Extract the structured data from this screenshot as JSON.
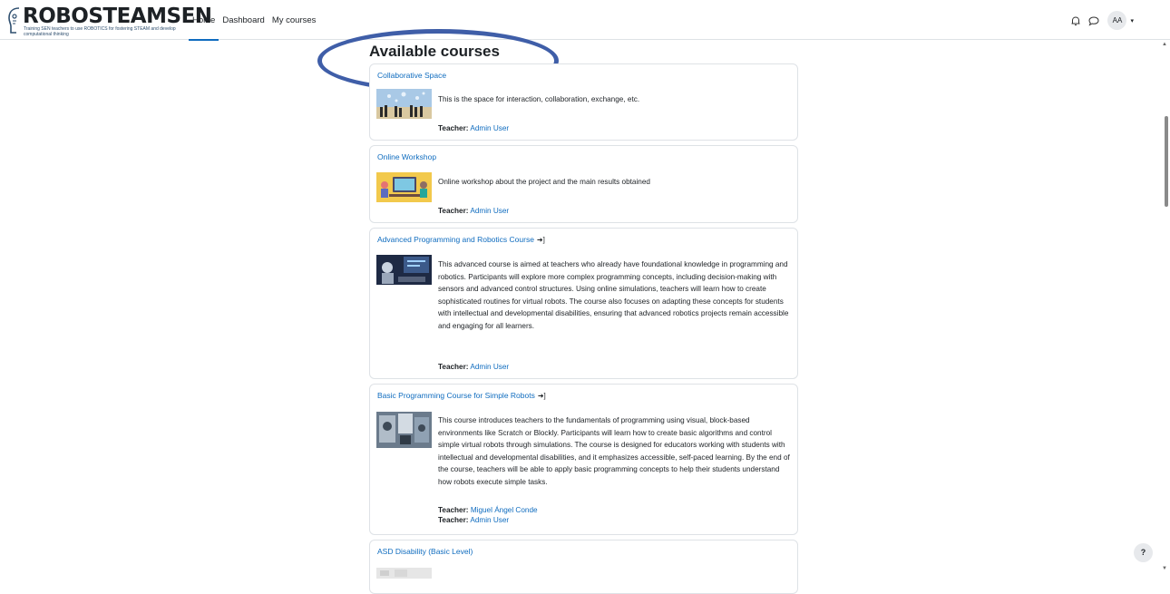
{
  "brand": {
    "title": "ROBOSTEAMSEN",
    "tagline": "Training SEN teachers to use ROBOTICS for fostering STEAM and develop computational thinking"
  },
  "nav": {
    "links": [
      "Home",
      "Dashboard",
      "My courses"
    ],
    "active": "Home",
    "user_initials": "AA",
    "icons": [
      "bell-icon",
      "chat-icon",
      "chevron-down-icon"
    ]
  },
  "page": {
    "title": "Available courses"
  },
  "courses": [
    {
      "name": "Collaborative Space",
      "summary": "This is the space for interaction, collaboration, exchange, etc.",
      "teachers": [
        {
          "label": "Teacher:",
          "name": "Admin User"
        }
      ],
      "enrol_icon": false
    },
    {
      "name": "Online Workshop",
      "summary": "Online workshop about the project and the main results obtained",
      "teachers": [
        {
          "label": "Teacher:",
          "name": "Admin User"
        }
      ],
      "enrol_icon": false
    },
    {
      "name": "Advanced Programming and Robotics Course",
      "summary": "This advanced course is aimed at teachers who already have foundational knowledge in programming and robotics. Participants will explore more complex programming concepts, including decision-making with sensors and advanced control structures. Using online simulations, teachers will learn how to create sophisticated routines for virtual robots. The course also focuses on adapting these concepts for students with intellectual and developmental disabilities, ensuring that advanced robotics projects remain accessible and engaging for all learners.",
      "teachers": [
        {
          "label": "Teacher:",
          "name": "Admin User"
        }
      ],
      "enrol_icon": true
    },
    {
      "name": "Basic Programming Course for Simple Robots",
      "summary": "This course introduces teachers to the fundamentals of programming using visual, block-based environments like Scratch or Blockly. Participants will learn how to create basic algorithms and control simple virtual robots through simulations. The course is designed for educators working with students with intellectual and developmental disabilities, and it emphasizes accessible, self-paced learning. By the end of the course, teachers will be able to apply basic programming concepts to help their students understand how robots execute simple tasks.",
      "teachers": [
        {
          "label": "Teacher:",
          "name": "Miguel Ángel Conde"
        },
        {
          "label": "Teacher:",
          "name": "Admin User"
        }
      ],
      "enrol_icon": true
    },
    {
      "name": "ASD Disability (Basic Level)",
      "summary": "",
      "teachers": [],
      "enrol_icon": false
    }
  ],
  "help": {
    "label": "?"
  },
  "colors": {
    "link": "#0f6cbf",
    "annotation": "#3f5ea8",
    "border": "#dee2e6"
  }
}
